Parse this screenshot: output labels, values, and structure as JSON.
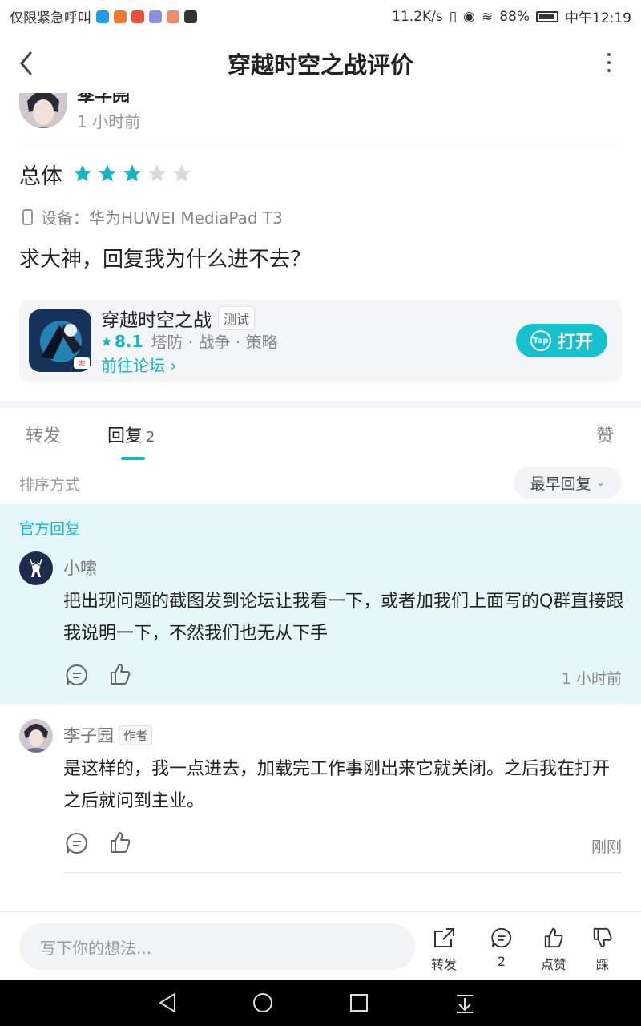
{
  "status_bar": {
    "left_text": "仅限紧急呼叫",
    "speed": "11.2K/s",
    "battery": "88%",
    "time": "中午12:19"
  },
  "header": {
    "title": "穿越时空之战评价"
  },
  "review": {
    "author_name": "李子园",
    "time_ago": "1 小时前",
    "overall_label": "总体",
    "rating_stars": 3,
    "rating_max": 5,
    "device_label": "设备：华为HUWEI MediaPad T3",
    "text": "求大神，回复我为什么进不去？"
  },
  "game_card": {
    "name": "穿越时空之战",
    "badge": "测试",
    "score": "8.1",
    "tags": "塔防 · 战争 · 策略",
    "forum_link": "前往论坛",
    "open_button": "打开",
    "tap_icon_text": "Tap"
  },
  "tabs": {
    "forward": "转发",
    "reply": "回复",
    "reply_count": "2",
    "like": "赞"
  },
  "sort": {
    "label": "排序方式",
    "value": "最早回复"
  },
  "official_reply": {
    "section_label": "官方回复",
    "name": "小嗦",
    "text": "把出现问题的截图发到论坛让我看一下，或者加我们上面写的Q群直接跟我说明一下，不然我们也无从下手",
    "time": "1 小时前"
  },
  "author_reply": {
    "name": "李子园",
    "badge": "作者",
    "text": "是这样的，我一点进去，加载完工作事刚出来它就关闭。之后我在打开之后就问到主业。",
    "time": "刚刚"
  },
  "bottom_bar": {
    "placeholder": "写下你的想法...",
    "forward": "转发",
    "comment_count": "2",
    "like": "点赞",
    "dislike": "踩"
  },
  "colors": {
    "accent": "#15b5c6",
    "official_bg": "#e5f7f9",
    "star_off": "#d6dadd"
  }
}
